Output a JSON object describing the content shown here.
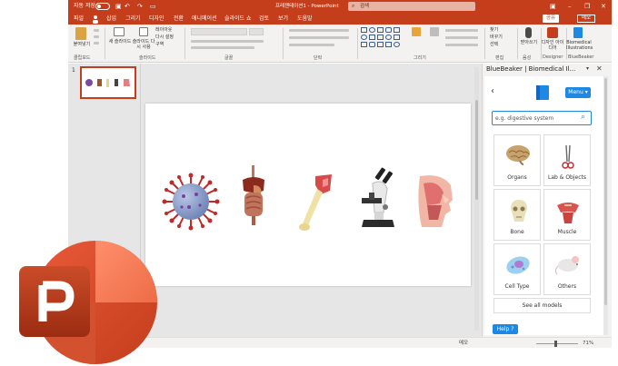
{
  "titlebar": {
    "autosave_label": "자동 저장",
    "doc_title": "프레젠테이션1 - PowerPoint",
    "search_placeholder": "검색",
    "icons": [
      "save-icon",
      "undo-icon",
      "redo-icon",
      "present-icon",
      "minimize-icon",
      "restore-icon",
      "close-icon"
    ]
  },
  "tabs": {
    "items": [
      "파일",
      "홈",
      "삽입",
      "그리기",
      "디자인",
      "전환",
      "애니메이션",
      "슬라이드 쇼",
      "검토",
      "보기",
      "도움말"
    ],
    "active": "홈",
    "share_label": "공유",
    "comment_label": "메모"
  },
  "ribbon": {
    "paste_label": "붙여넣기",
    "new_slide_label": "새 슬라이드",
    "reuse_label": "슬라이드 다시 사용",
    "layout_label": "레이아웃",
    "reset_label": "다시 설정",
    "section_label": "구역",
    "find_label": "찾기",
    "replace_label": "바꾸기",
    "select_label": "선택",
    "dictate_label": "받아쓰기",
    "designer_label": "디자인 아이디어",
    "bluebeaker_label": "Biomedical Illustrations",
    "groups": [
      "클립보드",
      "슬라이드",
      "글꼴",
      "단락",
      "그리기",
      "편집",
      "음성",
      "Designer",
      "BlueBeaker"
    ]
  },
  "thumbnails": {
    "slide_number": "1"
  },
  "statusbar": {
    "notes_label": "메모",
    "zoom_percent": "71%"
  },
  "pane": {
    "title": "BlueBeaker | Biomedical Il...",
    "menu_label": "Menu",
    "search_placeholder": "e.g. digestive system",
    "categories": [
      {
        "label": "Organs",
        "icon": "brain-icon"
      },
      {
        "label": "Lab & Objects",
        "icon": "forceps-icon"
      },
      {
        "label": "Bone",
        "icon": "skull-icon"
      },
      {
        "label": "Muscle",
        "icon": "muscle-icon"
      },
      {
        "label": "Cell Type",
        "icon": "cell-icon"
      },
      {
        "label": "Others",
        "icon": "mouse-icon"
      }
    ],
    "see_all_label": "See all models",
    "help_label": "Help ?"
  },
  "slide": {
    "objects": [
      "virus-icon",
      "digestive-organs-icon",
      "bone-icon",
      "microscope-icon",
      "head-anatomy-icon"
    ]
  },
  "colors": {
    "ppt_red": "#c43e1c",
    "bluebeaker_blue": "#1e88e5",
    "ribbon_gray": "#f3f2f1"
  }
}
